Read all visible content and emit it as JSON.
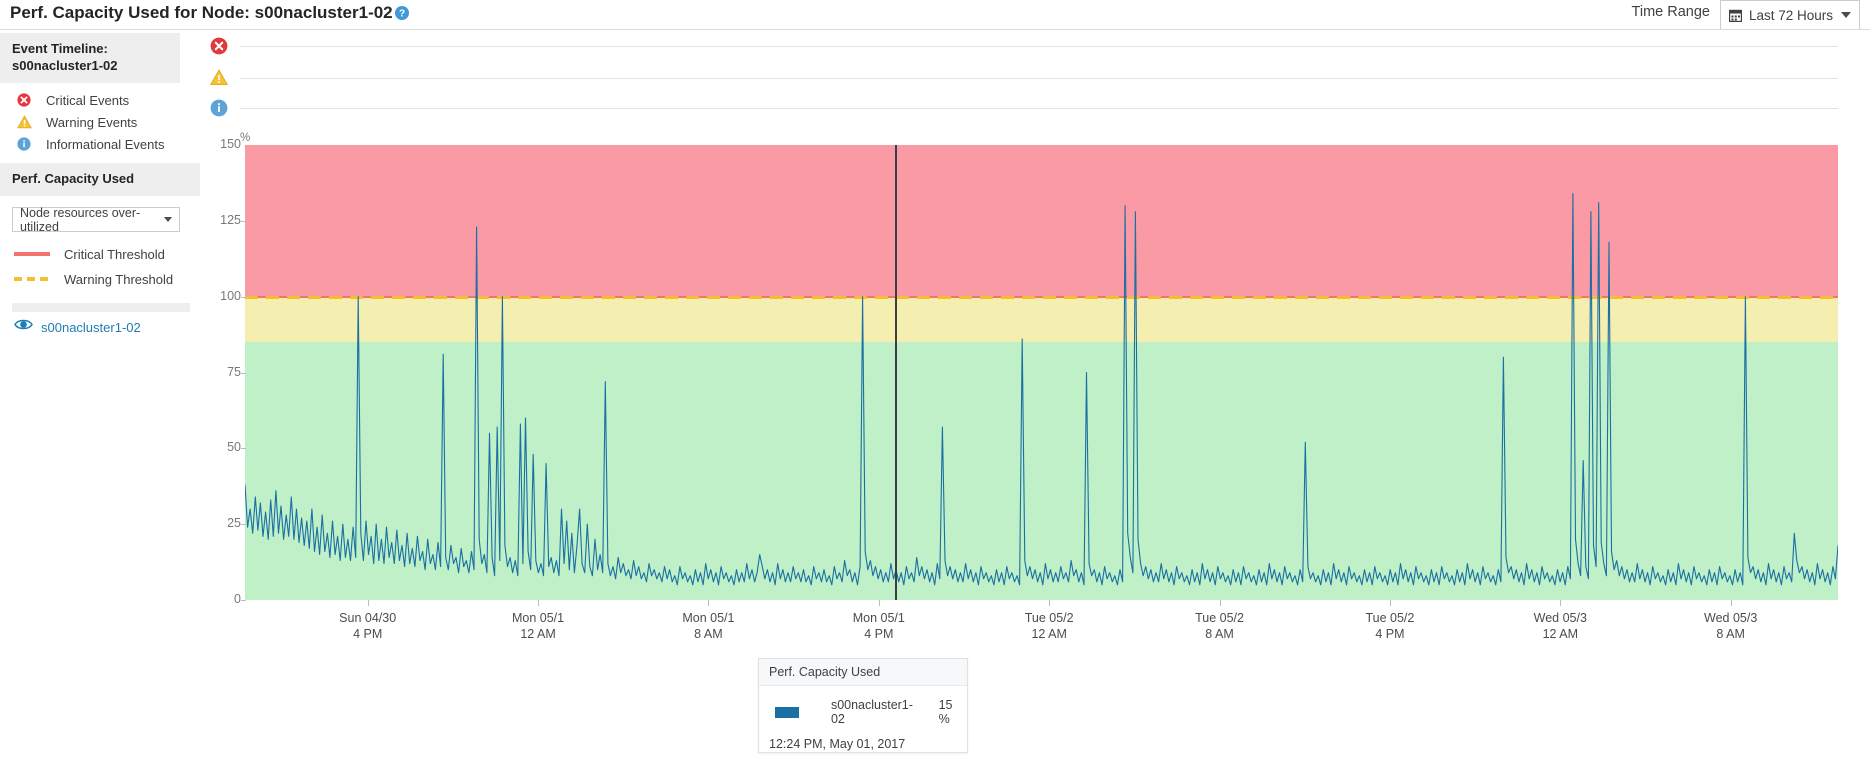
{
  "header": {
    "title": "Perf. Capacity Used for Node: s00nacluster1-02",
    "help_icon": "help-circle-icon",
    "time_range_label": "Time Range",
    "time_range_value": "Last 72 Hours",
    "calendar_icon": "calendar-icon",
    "caret_icon": "chevron-down-icon"
  },
  "sidebar": {
    "event_timeline_title": "Event Timeline:",
    "event_timeline_node": "s00nacluster1-02",
    "event_legend": [
      {
        "icon": "critical-error-icon",
        "label": "Critical Events",
        "color": "#e0393e"
      },
      {
        "icon": "warning-triangle-icon",
        "label": "Warning Events",
        "color": "#f5c232"
      },
      {
        "icon": "information-circle-icon",
        "label": "Informational Events",
        "color": "#5ba3d9"
      }
    ],
    "perf_capacity_title": "Perf. Capacity Used",
    "metric_select_value": "Node resources over-utilized",
    "thresholds": [
      {
        "label": "Critical Threshold",
        "style": "solid",
        "color": "#f2736f"
      },
      {
        "label": "Warning Threshold",
        "style": "dashed",
        "color": "#f5bd32"
      }
    ],
    "node_series": {
      "icon": "eye-visible-icon",
      "label": "s00nacluster1-02",
      "color": "#1c7eb5"
    }
  },
  "tooltip": {
    "title": "Perf. Capacity Used",
    "series_name": "s00nacluster1-02",
    "series_value": "15 %",
    "timestamp": "12:24 PM, May 01, 2017",
    "swatch_color": "#1a6fa3"
  },
  "chart_data": {
    "type": "line",
    "title": "Perf. Capacity Used for Node: s00nacluster1-02",
    "xlabel": "",
    "ylabel": "%",
    "ylim": [
      0,
      150
    ],
    "yticks": [
      0,
      25,
      50,
      75,
      100,
      125,
      150
    ],
    "grid": false,
    "legend_position": "left-sidebar",
    "series": [
      {
        "name": "s00nacluster1-02",
        "color": "#1a6fa3"
      }
    ],
    "xticks": [
      {
        "date": "Sun 04/30",
        "time": "4 PM"
      },
      {
        "date": "Mon 05/1",
        "time": "12 AM"
      },
      {
        "date": "Mon 05/1",
        "time": "8 AM"
      },
      {
        "date": "Mon 05/1",
        "time": "4 PM"
      },
      {
        "date": "Tue 05/2",
        "time": "12 AM"
      },
      {
        "date": "Tue 05/2",
        "time": "8 AM"
      },
      {
        "date": "Tue 05/2",
        "time": "4 PM"
      },
      {
        "date": "Wed 05/3",
        "time": "12 AM"
      },
      {
        "date": "Wed 05/3",
        "time": "8 AM"
      }
    ],
    "bands": [
      {
        "name": "critical",
        "from": 100,
        "to": 150,
        "color": "#fa9aa4"
      },
      {
        "name": "warning",
        "from": 85,
        "to": 100,
        "color": "#f4eeb0"
      },
      {
        "name": "ok",
        "from": 0,
        "to": 85,
        "color": "#bff0c7"
      }
    ],
    "thresholds": [
      {
        "name": "Critical Threshold",
        "value": 100,
        "color": "#f2736f",
        "style": "solid"
      },
      {
        "name": "Warning Threshold",
        "value": 100,
        "color": "#f5bd32",
        "style": "dashed"
      }
    ],
    "cursor": {
      "x_label": "12:24 PM, May 01, 2017",
      "value": 15
    },
    "values": [
      38,
      24,
      30,
      22,
      34,
      23,
      32,
      21,
      29,
      20,
      33,
      21,
      36,
      22,
      31,
      20,
      28,
      21,
      34,
      20,
      30,
      19,
      27,
      18,
      26,
      17,
      30,
      16,
      24,
      15,
      28,
      16,
      22,
      14,
      26,
      15,
      21,
      13,
      25,
      14,
      20,
      13,
      24,
      14,
      100,
      22,
      13,
      26,
      15,
      21,
      12,
      25,
      13,
      20,
      12,
      24,
      14,
      19,
      12,
      23,
      13,
      18,
      11,
      22,
      12,
      17,
      11,
      21,
      13,
      16,
      10,
      20,
      12,
      15,
      10,
      19,
      11,
      81,
      14,
      10,
      18,
      12,
      14,
      9,
      17,
      11,
      13,
      9,
      16,
      10,
      123,
      20,
      12,
      15,
      9,
      55,
      14,
      8,
      57,
      13,
      100,
      18,
      11,
      14,
      9,
      13,
      8,
      58,
      12,
      60,
      16,
      10,
      48,
      13,
      9,
      12,
      8,
      45,
      11,
      14,
      9,
      13,
      8,
      30,
      12,
      26,
      10,
      22,
      9,
      18,
      30,
      12,
      9,
      25,
      11,
      8,
      20,
      10,
      15,
      9,
      72,
      12,
      8,
      11,
      7,
      14,
      9,
      12,
      8,
      10,
      7,
      13,
      8,
      11,
      7,
      9,
      6,
      12,
      8,
      10,
      7,
      9,
      6,
      11,
      7,
      10,
      6,
      8,
      5,
      11,
      7,
      9,
      6,
      8,
      5,
      10,
      6,
      9,
      5,
      12,
      7,
      10,
      6,
      9,
      5,
      11,
      7,
      9,
      6,
      8,
      5,
      10,
      6,
      9,
      6,
      12,
      7,
      10,
      6,
      9,
      15,
      11,
      7,
      10,
      6,
      9,
      5,
      12,
      7,
      10,
      6,
      9,
      6,
      11,
      7,
      9,
      6,
      10,
      6,
      8,
      5,
      11,
      7,
      9,
      6,
      10,
      6,
      8,
      5,
      11,
      7,
      9,
      6,
      13,
      8,
      10,
      6,
      9,
      5,
      11,
      100,
      16,
      10,
      13,
      8,
      11,
      7,
      10,
      6,
      9,
      6,
      12,
      7,
      10,
      6,
      9,
      5,
      11,
      7,
      9,
      6,
      14,
      8,
      11,
      7,
      10,
      6,
      9,
      5,
      12,
      7,
      57,
      13,
      8,
      11,
      7,
      10,
      6,
      9,
      6,
      12,
      7,
      10,
      6,
      9,
      5,
      11,
      7,
      9,
      6,
      8,
      5,
      10,
      6,
      9,
      5,
      11,
      7,
      9,
      6,
      8,
      5,
      86,
      13,
      8,
      11,
      7,
      10,
      6,
      9,
      5,
      12,
      7,
      10,
      6,
      9,
      6,
      11,
      7,
      9,
      6,
      13,
      8,
      10,
      6,
      9,
      5,
      75,
      12,
      8,
      10,
      6,
      9,
      5,
      11,
      7,
      9,
      6,
      8,
      5,
      10,
      6,
      130,
      22,
      14,
      9,
      128,
      20,
      12,
      8,
      11,
      7,
      10,
      6,
      9,
      6,
      12,
      7,
      10,
      6,
      9,
      5,
      11,
      7,
      9,
      6,
      8,
      5,
      10,
      6,
      9,
      5,
      12,
      7,
      10,
      6,
      9,
      5,
      11,
      7,
      9,
      6,
      8,
      5,
      10,
      6,
      9,
      5,
      11,
      7,
      9,
      6,
      8,
      5,
      10,
      6,
      9,
      5,
      12,
      7,
      10,
      6,
      9,
      5,
      11,
      7,
      9,
      6,
      8,
      5,
      10,
      6,
      52,
      11,
      7,
      9,
      6,
      8,
      5,
      10,
      6,
      9,
      5,
      12,
      7,
      10,
      6,
      9,
      5,
      11,
      7,
      9,
      6,
      8,
      5,
      10,
      6,
      9,
      5,
      11,
      7,
      9,
      6,
      8,
      5,
      10,
      6,
      9,
      5,
      12,
      7,
      10,
      6,
      9,
      5,
      11,
      7,
      9,
      6,
      8,
      5,
      10,
      6,
      9,
      5,
      11,
      7,
      9,
      6,
      8,
      5,
      10,
      6,
      9,
      5,
      12,
      7,
      10,
      6,
      9,
      5,
      11,
      7,
      9,
      6,
      8,
      5,
      10,
      6,
      80,
      14,
      9,
      11,
      7,
      10,
      6,
      9,
      5,
      12,
      7,
      10,
      6,
      9,
      5,
      11,
      7,
      9,
      6,
      8,
      5,
      10,
      6,
      9,
      5,
      11,
      7,
      134,
      20,
      12,
      8,
      46,
      11,
      7,
      128,
      18,
      11,
      131,
      19,
      12,
      8,
      118,
      16,
      10,
      13,
      8,
      11,
      7,
      10,
      6,
      9,
      6,
      12,
      7,
      10,
      6,
      9,
      5,
      11,
      7,
      9,
      6,
      8,
      5,
      10,
      6,
      9,
      5,
      12,
      7,
      10,
      6,
      9,
      5,
      11,
      7,
      9,
      6,
      8,
      5,
      10,
      6,
      9,
      5,
      11,
      7,
      9,
      6,
      8,
      5,
      10,
      6,
      9,
      5,
      100,
      14,
      9,
      11,
      7,
      10,
      6,
      9,
      5,
      12,
      7,
      10,
      6,
      9,
      5,
      11,
      7,
      9,
      6,
      22,
      13,
      9,
      11,
      7,
      10,
      6,
      9,
      5,
      12,
      7,
      10,
      6,
      9,
      5,
      11,
      7,
      18
    ]
  }
}
